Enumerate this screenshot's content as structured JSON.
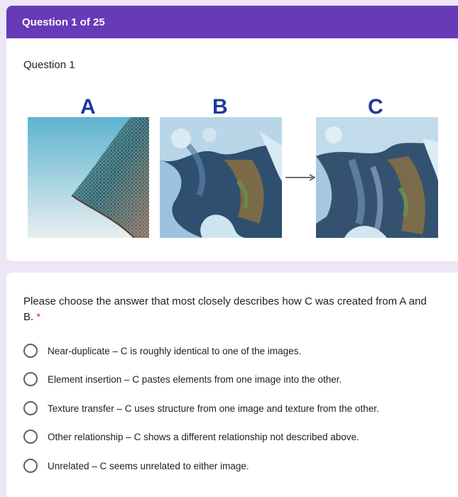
{
  "header": {
    "progress": "Question 1 of 25"
  },
  "question": {
    "title": "Question 1",
    "image_labels": {
      "a": "A",
      "b": "B",
      "c": "C"
    },
    "prompt": "Please choose the answer that most closely describes how C was created from A and B.",
    "required_mark": "*"
  },
  "options": [
    {
      "label": "Near-duplicate – C is roughly identical to one of the images."
    },
    {
      "label": "Element insertion – C pastes elements from one image into the other."
    },
    {
      "label": "Texture transfer – C uses structure from one image and texture from the other."
    },
    {
      "label": "Other relationship – C shows a different relationship not described above."
    },
    {
      "label": "Unrelated – C seems unrelated to either image."
    }
  ],
  "colors": {
    "accent": "#673ab7",
    "required": "#d93025",
    "background": "#ece6f6"
  }
}
